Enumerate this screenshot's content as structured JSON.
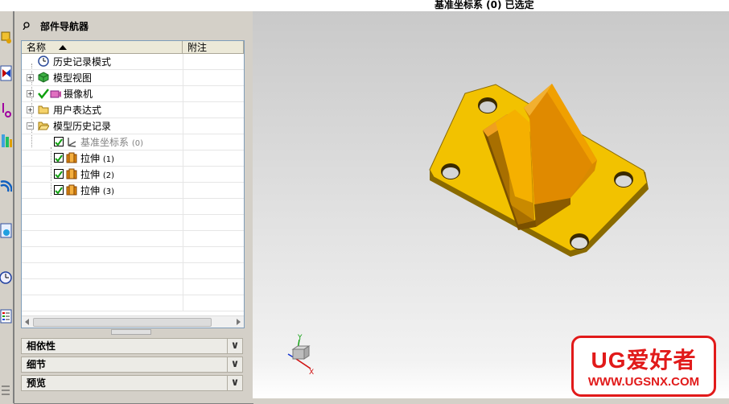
{
  "status": {
    "text": "基准坐标系 (0) 已选定"
  },
  "navigator": {
    "title": "部件导航器",
    "columns": {
      "name": "名称",
      "note": "附注"
    },
    "items": [
      {
        "label": "历史记录模式",
        "icon": "clock-icon",
        "expand": ""
      },
      {
        "label": "模型视图",
        "icon": "model-view-icon",
        "expand": "+"
      },
      {
        "label": "摄像机",
        "icon": "camera-icon",
        "expand": "+"
      },
      {
        "label": "用户表达式",
        "icon": "folder-icon",
        "expand": "+"
      },
      {
        "label": "模型历史记录",
        "icon": "folder-open-icon",
        "expand": "−"
      },
      {
        "label": "基准坐标系",
        "suffix": "(0)",
        "icon": "datum-csys-icon",
        "checked": true,
        "greyed": true
      },
      {
        "label": "拉伸",
        "suffix": "(1)",
        "icon": "extrude-icon",
        "checked": true
      },
      {
        "label": "拉伸",
        "suffix": "(2)",
        "icon": "extrude-icon",
        "checked": true
      },
      {
        "label": "拉伸",
        "suffix": "(3)",
        "icon": "extrude-icon",
        "checked": true
      }
    ],
    "panels": [
      {
        "label": "相依性"
      },
      {
        "label": "细节"
      },
      {
        "label": "预览"
      }
    ]
  },
  "triad": {
    "x": "X",
    "y": "Y"
  },
  "logo": {
    "main": "UG爱好者",
    "url": "WWW.UGSNX.COM"
  },
  "colors": {
    "part": "#f2c200",
    "accent": "#e11a1a"
  }
}
